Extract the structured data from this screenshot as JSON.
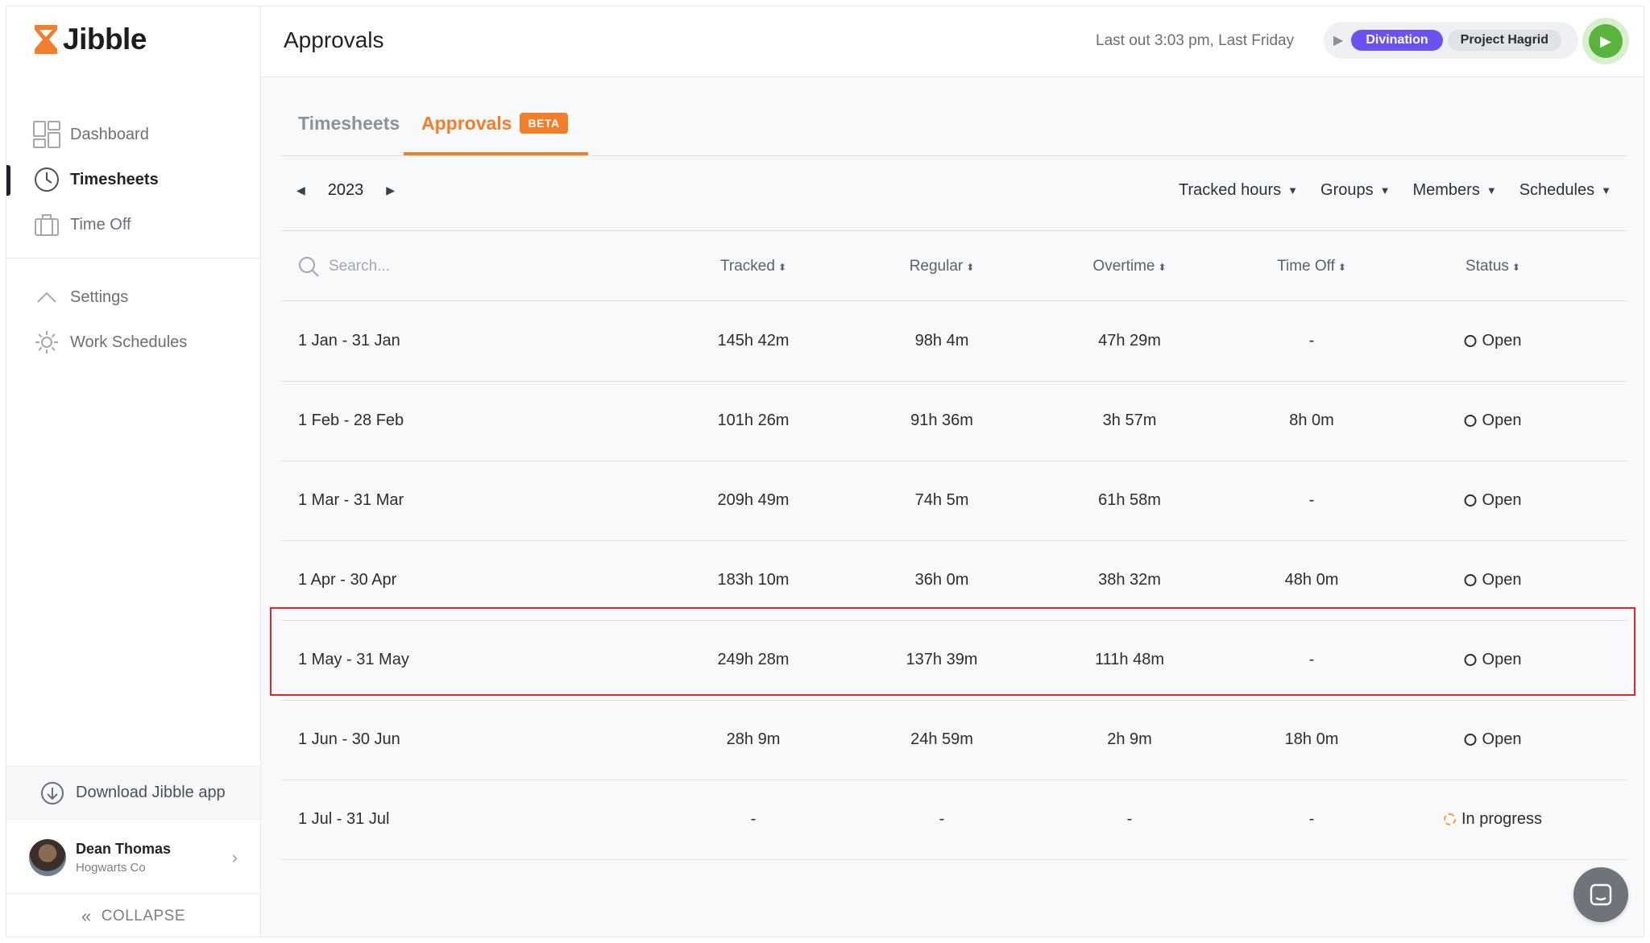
{
  "brand": {
    "name": "Jibble"
  },
  "sidebar": {
    "items": [
      {
        "label": "Dashboard"
      },
      {
        "label": "Timesheets"
      },
      {
        "label": "Time Off"
      },
      {
        "label": "Settings"
      },
      {
        "label": "Work Schedules"
      }
    ],
    "download_label": "Download Jibble app",
    "user": {
      "name": "Dean Thomas",
      "org": "Hogwarts Co"
    },
    "collapse_label": "COLLAPSE"
  },
  "header": {
    "title": "Approvals",
    "last_out": "Last out 3:03 pm, Last Friday",
    "activity_tag": "Divination",
    "project_tag": "Project Hagrid"
  },
  "tabs": [
    {
      "label": "Timesheets"
    },
    {
      "label": "Approvals",
      "badge": "BETA"
    }
  ],
  "toolbar": {
    "year": "2023",
    "filters": [
      "Tracked hours",
      "Groups",
      "Members",
      "Schedules"
    ]
  },
  "table": {
    "search_placeholder": "Search...",
    "columns": [
      "Tracked",
      "Regular",
      "Overtime",
      "Time Off",
      "Status"
    ],
    "rows": [
      {
        "period": "1 Jan - 31 Jan",
        "tracked": "145h 42m",
        "regular": "98h 4m",
        "overtime": "47h 29m",
        "time_off": "-",
        "status": "Open"
      },
      {
        "period": "1 Feb - 28 Feb",
        "tracked": "101h 26m",
        "regular": "91h 36m",
        "overtime": "3h 57m",
        "time_off": "8h 0m",
        "status": "Open"
      },
      {
        "period": "1 Mar - 31 Mar",
        "tracked": "209h 49m",
        "regular": "74h 5m",
        "overtime": "61h 58m",
        "time_off": "-",
        "status": "Open"
      },
      {
        "period": "1 Apr - 30 Apr",
        "tracked": "183h 10m",
        "regular": "36h 0m",
        "overtime": "38h 32m",
        "time_off": "48h 0m",
        "status": "Open"
      },
      {
        "period": "1 May - 31 May",
        "tracked": "249h 28m",
        "regular": "137h 39m",
        "overtime": "111h 48m",
        "time_off": "-",
        "status": "Open"
      },
      {
        "period": "1 Jun - 30 Jun",
        "tracked": "28h 9m",
        "regular": "24h 59m",
        "overtime": "2h 9m",
        "time_off": "18h 0m",
        "status": "Open"
      },
      {
        "period": "1 Jul - 31 Jul",
        "tracked": "-",
        "regular": "-",
        "overtime": "-",
        "time_off": "-",
        "status": "In progress"
      }
    ]
  },
  "colors": {
    "accent": "#f27d2a",
    "activity": "#6952f0",
    "clock_in": "#58b43c",
    "highlight": "#e0262b"
  }
}
